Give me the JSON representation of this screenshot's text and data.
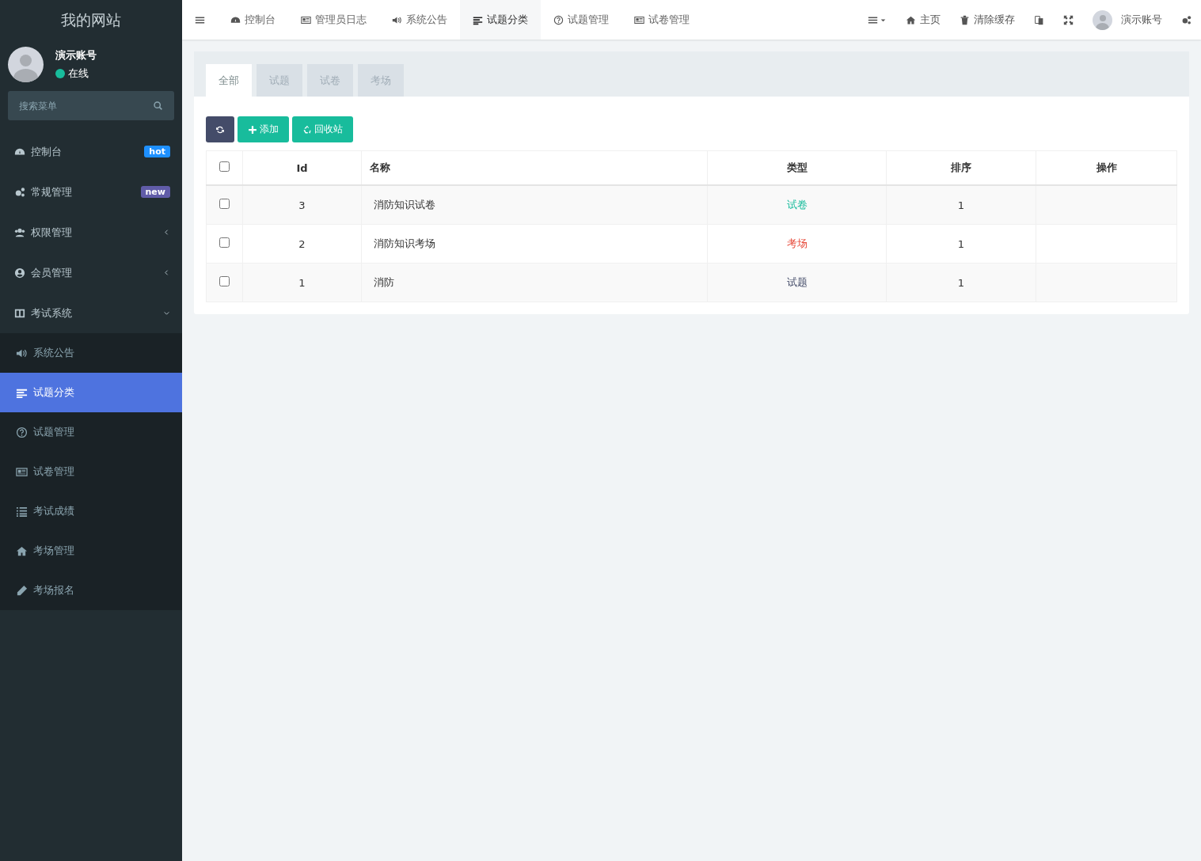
{
  "sidebar": {
    "logo": "我的网站",
    "user": {
      "name": "演示账号",
      "status": "在线",
      "online": true
    },
    "search": {
      "placeholder": "搜索菜单"
    },
    "items": [
      {
        "label": "控制台",
        "badge": {
          "text": "hot",
          "color": "#1e90ff"
        }
      },
      {
        "label": "常规管理",
        "badge": {
          "text": "new",
          "color": "#605ca8"
        }
      },
      {
        "label": "权限管理",
        "expanded": false
      },
      {
        "label": "会员管理",
        "expanded": false
      },
      {
        "label": "考试系统",
        "expanded": true,
        "children": [
          {
            "label": "系统公告",
            "selected": false
          },
          {
            "label": "试题分类",
            "selected": true
          },
          {
            "label": "试题管理",
            "selected": false
          },
          {
            "label": "试卷管理",
            "selected": false
          },
          {
            "label": "考试成绩",
            "selected": false
          },
          {
            "label": "考场管理",
            "selected": false
          },
          {
            "label": "考场报名",
            "selected": false
          }
        ]
      }
    ]
  },
  "topbar": {
    "tabs": [
      {
        "label": "控制台",
        "selected": false
      },
      {
        "label": "管理员日志",
        "selected": false
      },
      {
        "label": "系统公告",
        "selected": false
      },
      {
        "label": "试题分类",
        "selected": true
      },
      {
        "label": "试题管理",
        "selected": false
      },
      {
        "label": "试卷管理",
        "selected": false
      }
    ],
    "home": "主页",
    "clear_cache": "清除缓存",
    "user": "演示账号"
  },
  "panel": {
    "tabs": [
      {
        "label": "全部",
        "selected": true
      },
      {
        "label": "试题",
        "selected": false
      },
      {
        "label": "试卷",
        "selected": false
      },
      {
        "label": "考场",
        "selected": false
      }
    ],
    "buttons": {
      "add": "添加",
      "recycle": "回收站"
    },
    "table": {
      "all_checked": false,
      "columns": [
        "Id",
        "名称",
        "类型",
        "排序",
        "操作"
      ],
      "rows": [
        {
          "checked": false,
          "id": "3",
          "name": "消防知识试卷",
          "type": "试卷",
          "color": "#18bc9c",
          "order": "1"
        },
        {
          "checked": false,
          "id": "2",
          "name": "消防知识考场",
          "type": "考场",
          "color": "#e74c3c",
          "order": "1"
        },
        {
          "checked": false,
          "id": "1",
          "name": "消防",
          "type": "试题",
          "color": "#444c69",
          "order": "1"
        }
      ]
    }
  }
}
